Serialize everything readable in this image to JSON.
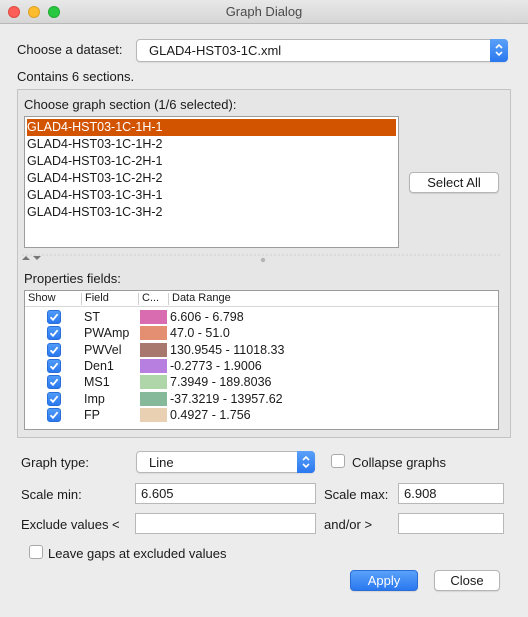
{
  "window": {
    "title": "Graph Dialog"
  },
  "dataset": {
    "label": "Choose a dataset:",
    "value": "GLAD4-HST03-1C.xml",
    "info": "Contains 6 sections."
  },
  "sections": {
    "label": "Choose graph section (1/6 selected):",
    "items": [
      "GLAD4-HST03-1C-1H-1",
      "GLAD4-HST03-1C-1H-2",
      "GLAD4-HST03-1C-2H-1",
      "GLAD4-HST03-1C-2H-2",
      "GLAD4-HST03-1C-3H-1",
      "GLAD4-HST03-1C-3H-2"
    ],
    "selected_index": 0,
    "select_all_label": "Select All"
  },
  "properties": {
    "label": "Properties fields:",
    "headers": [
      "Show",
      "Field",
      "C...",
      "Data Range"
    ],
    "rows": [
      {
        "show": true,
        "field": "ST",
        "color": "#d96cb0",
        "range": "6.606 - 6.798"
      },
      {
        "show": true,
        "field": "PWAmp",
        "color": "#e48f72",
        "range": "47.0 - 51.0"
      },
      {
        "show": true,
        "field": "PWVel",
        "color": "#a8786e",
        "range": "130.9545 - 11018.33"
      },
      {
        "show": true,
        "field": "Den1",
        "color": "#b77fe0",
        "range": "-0.2773 - 1.9006"
      },
      {
        "show": true,
        "field": "MS1",
        "color": "#aed6a9",
        "range": "7.3949 - 189.8036"
      },
      {
        "show": true,
        "field": "Imp",
        "color": "#86b99a",
        "range": "-37.3219 - 13957.62"
      },
      {
        "show": true,
        "field": "FP",
        "color": "#ead0b2",
        "range": "0.4927 - 1.756"
      }
    ]
  },
  "graph": {
    "type_label": "Graph type:",
    "type_value": "Line",
    "collapse_label": "Collapse graphs",
    "collapse_checked": false,
    "scale_min_label": "Scale min:",
    "scale_min_value": "6.605",
    "scale_max_label": "Scale max:",
    "scale_max_value": "6.908",
    "exclude_label": "Exclude values <",
    "exclude_value": "",
    "andor_label": "and/or >",
    "andor_value": "",
    "gaps_label": "Leave gaps at excluded values",
    "gaps_checked": false
  },
  "buttons": {
    "apply": "Apply",
    "close": "Close"
  },
  "colors": {
    "selection": "#d35400",
    "accent": "#2a78ef"
  }
}
